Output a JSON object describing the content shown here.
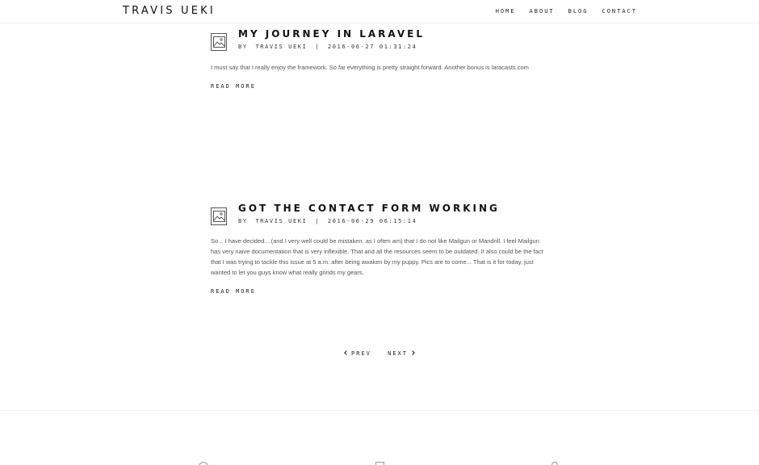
{
  "header": {
    "brand": "TRAVIS UEKI",
    "nav": [
      "HOME",
      "ABOUT",
      "BLOG",
      "CONTACT"
    ]
  },
  "posts": [
    {
      "title": "MY JOURNEY IN LARAVEL",
      "by": "BY",
      "author": "TRAVIS UEKI",
      "separator": "|",
      "timestamp": "2016-06-27 01:31:24",
      "excerpt": "I must say that I really enjoy the framework. So far everything is pretty straight forward. Another bonus is laracasts.com",
      "read_more": "READ MORE"
    },
    {
      "title": "GOT THE CONTACT FORM WORKING",
      "by": "BY",
      "author": "TRAVIS UEKI",
      "separator": "|",
      "timestamp": "2016-06-29 06:15:14",
      "excerpt": "So... I have decided... (and I very well could be mistaken, as I often am) that I do not like Mailgun or Mandrill. I feel Mailgun has very naive documentation that is very inflexible. That and all the resources seem to be outdated. It also could be the fact that I was trying to tackle this issue at 5 a.m. after being awaken by my puppy. Pics are to come... That is it for today, just wanted to let you guys know what really grinds my gears.",
      "read_more": "READ MORE"
    }
  ],
  "pagination": {
    "prev": "PREV",
    "next": "NEXT"
  },
  "footer": {
    "icons": [
      "location-icon",
      "mail-icon",
      "pin-icon"
    ]
  }
}
